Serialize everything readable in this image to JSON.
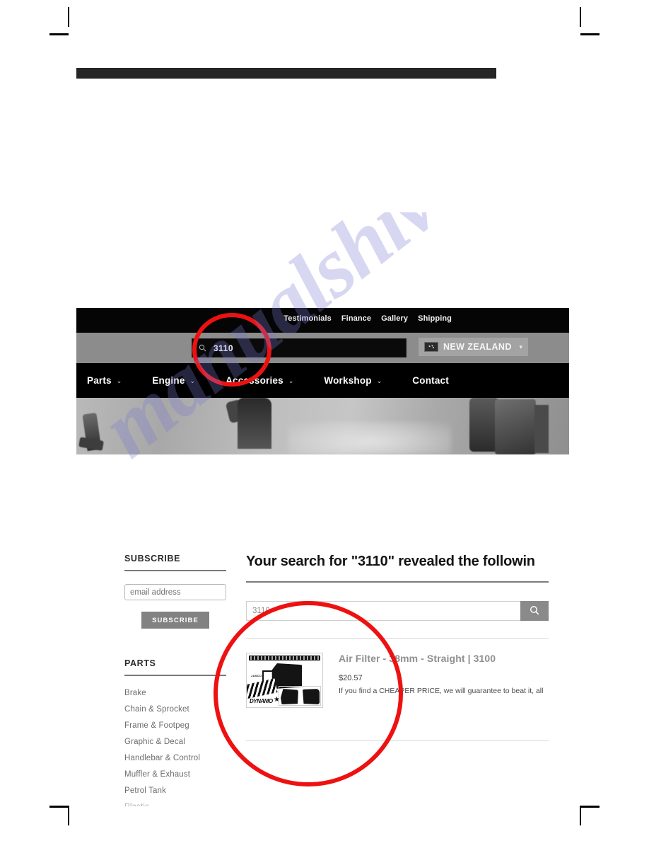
{
  "document": {
    "watermark": "manualshive.com"
  },
  "site_header": {
    "utility_links": [
      {
        "label": "Testimonials"
      },
      {
        "label": "Finance"
      },
      {
        "label": "Gallery"
      },
      {
        "label": "Shipping"
      }
    ],
    "search": {
      "value": "3110",
      "icon": "search-icon"
    },
    "locale": {
      "label": "NEW ZEALAND",
      "flag_icon": "new-zealand-flag-icon",
      "caret": "▾"
    },
    "nav": [
      {
        "label": "Parts",
        "caret": "⌄",
        "has_dropdown": true
      },
      {
        "label": "Engine",
        "caret": "⌄",
        "has_dropdown": true
      },
      {
        "label": "Accessories",
        "caret": "⌄",
        "has_dropdown": true
      },
      {
        "label": "Workshop",
        "caret": "⌄",
        "has_dropdown": true
      },
      {
        "label": "Contact",
        "caret": "",
        "has_dropdown": false
      }
    ]
  },
  "sidebar": {
    "subscribe": {
      "heading": "SUBSCRIBE",
      "email_placeholder": "email address",
      "email_value": "",
      "button_label": "SUBSCRIBE"
    },
    "parts": {
      "heading": "PARTS",
      "items": [
        {
          "label": "Brake"
        },
        {
          "label": "Chain & Sprocket"
        },
        {
          "label": "Frame & Footpeg"
        },
        {
          "label": "Graphic & Decal"
        },
        {
          "label": "Handlebar & Control"
        },
        {
          "label": "Muffler & Exhaust"
        },
        {
          "label": "Petrol Tank"
        },
        {
          "label": "Plastic"
        }
      ]
    }
  },
  "results": {
    "title": "Your search for \"3110\" revealed the followin",
    "search": {
      "value": "3110",
      "placeholder": "",
      "button_icon": "search-icon"
    },
    "products": [
      {
        "title": "Air Filter - 38mm - Straight | 3100",
        "price": "$20.57",
        "description": "If you find a CHEAPER PRICE, we will guarantee to beat it, all",
        "thumbnail_brand": "JASCO",
        "thumbnail_logo": "DYNAMO"
      }
    ]
  },
  "annotations": {
    "circle_color": "#ee1111",
    "items": [
      {
        "name": "header-search-highlight",
        "shape": "ellipse"
      },
      {
        "name": "search-result-highlight",
        "shape": "ellipse"
      }
    ]
  }
}
